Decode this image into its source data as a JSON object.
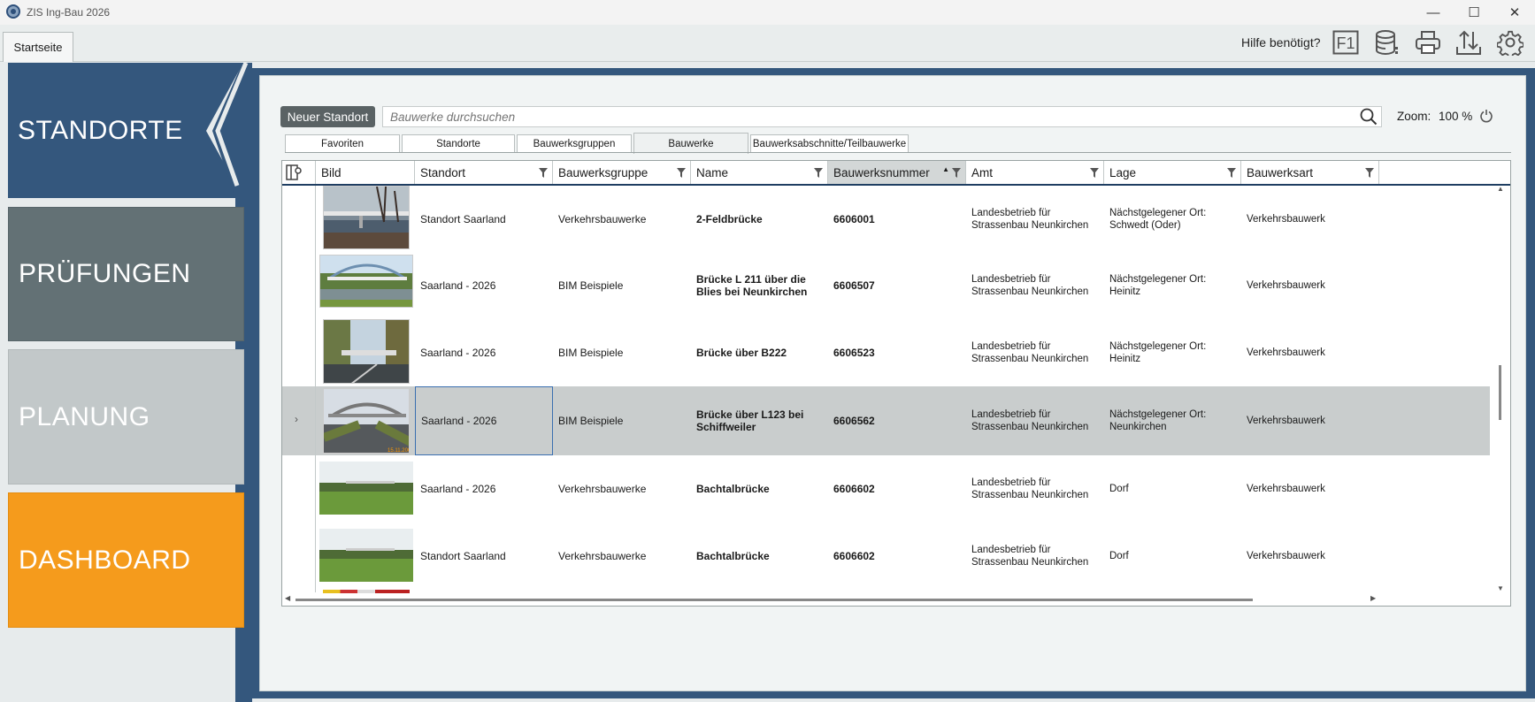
{
  "window": {
    "title": "ZIS Ing-Bau 2026"
  },
  "top_tabs": {
    "start": "Startseite"
  },
  "toolbar": {
    "help_text": "Hilfe benötigt?",
    "f1_label": "F1"
  },
  "nav": {
    "items": [
      {
        "label": "STANDORTE",
        "color": "#34577d",
        "active": true
      },
      {
        "label": "PRÜFUNGEN",
        "color": "#637175"
      },
      {
        "label": "PLANUNG",
        "color": "#c2c8c9"
      },
      {
        "label": "DASHBOARD",
        "color": "#f59b1c"
      }
    ]
  },
  "main": {
    "new_button": "Neuer Standort",
    "search_placeholder": "Bauwerke durchsuchen",
    "zoom_label": "Zoom:",
    "zoom_value": "100 %",
    "subtabs": [
      "Favoriten",
      "Standorte",
      "Bauwerksgruppen",
      "Bauwerke",
      "Bauwerksabschnitte/Teilbauwerke"
    ],
    "active_subtab": "Bauwerke"
  },
  "table": {
    "columns": [
      "Bild",
      "Standort",
      "Bauwerksgruppe",
      "Name",
      "Bauwerksnummer",
      "Amt",
      "Lage",
      "Bauwerksart"
    ],
    "sorted_column": "Bauwerksnummer",
    "rows": [
      {
        "standort": "Standort Saarland",
        "gruppe": "Verkehrsbauwerke",
        "name": "2-Feldbrücke",
        "nummer": "6606001",
        "amt": "Landesbetrieb für Strassenbau Neunkirchen",
        "lage": "Nächstgelegener Ort: Schwedt (Oder)",
        "art": "Verkehrsbauwerk",
        "selected": false
      },
      {
        "standort": "Saarland - 2026",
        "gruppe": "BIM Beispiele",
        "name": "Brücke L 211 über die Blies bei Neunkirchen",
        "nummer": "6606507",
        "amt": "Landesbetrieb für Strassenbau Neunkirchen",
        "lage": "Nächstgelegener Ort: Heinitz",
        "art": "Verkehrsbauwerk",
        "selected": false
      },
      {
        "standort": "Saarland - 2026",
        "gruppe": "BIM Beispiele",
        "name": "Brücke über B222",
        "nummer": "6606523",
        "amt": "Landesbetrieb für Strassenbau Neunkirchen",
        "lage": "Nächstgelegener Ort: Heinitz",
        "art": "Verkehrsbauwerk",
        "selected": false
      },
      {
        "standort": "Saarland - 2026",
        "gruppe": "BIM Beispiele",
        "name": "Brücke über L123 bei Schiffweiler",
        "nummer": "6606562",
        "amt": "Landesbetrieb für Strassenbau Neunkirchen",
        "lage": "Nächstgelegener Ort: Neunkirchen",
        "art": "Verkehrsbauwerk",
        "selected": true
      },
      {
        "standort": "Saarland - 2026",
        "gruppe": "Verkehrsbauwerke",
        "name": "Bachtalbrücke",
        "nummer": "6606602",
        "amt": "Landesbetrieb für Strassenbau Neunkirchen",
        "lage": "Dorf",
        "art": "Verkehrsbauwerk",
        "selected": false
      },
      {
        "standort": "Standort Saarland",
        "gruppe": "Verkehrsbauwerke",
        "name": "Bachtalbrücke",
        "nummer": "6606602",
        "amt": "Landesbetrieb für Strassenbau Neunkirchen",
        "lage": "Dorf",
        "art": "Verkehrsbauwerk",
        "selected": false
      }
    ]
  }
}
